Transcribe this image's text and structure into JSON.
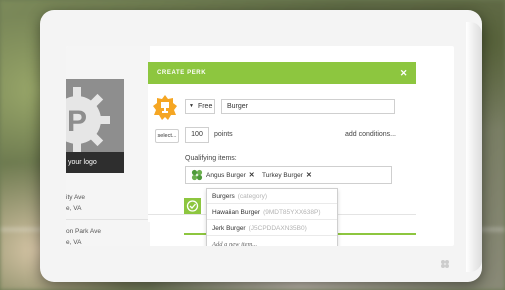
{
  "panel": {
    "title": "CREATE PERK",
    "close": "✕",
    "perk_type": "Free",
    "item_value": "Burger",
    "select_label": "select...",
    "points_value": "100",
    "points_label": "points",
    "add_conditions": "add conditions...",
    "qualifying_label": "Qualifying items:",
    "tokens": [
      {
        "label": "Angus Burger",
        "remove": "✕"
      },
      {
        "label": "Turkey Burger",
        "remove": "✕"
      }
    ]
  },
  "dropdown": {
    "items": [
      {
        "name": "Burgers",
        "meta": "(category)"
      },
      {
        "name": "Hawaiian Burger",
        "meta": "(9MDT85YXX638P)"
      },
      {
        "name": "Jerk Burger",
        "meta": "(J5CPDDAXN35B0)"
      }
    ],
    "add_new": "Add a new item..."
  },
  "profile": {
    "logo_letter": "P",
    "logo_label": "your logo",
    "addresses": [
      {
        "line1": "ity Ave",
        "line2": "e, VA"
      },
      {
        "line1": "on Park Ave",
        "line2": "e, VA"
      }
    ]
  },
  "colors": {
    "accent": "#8dc63f",
    "trophy": "#f5a623"
  }
}
